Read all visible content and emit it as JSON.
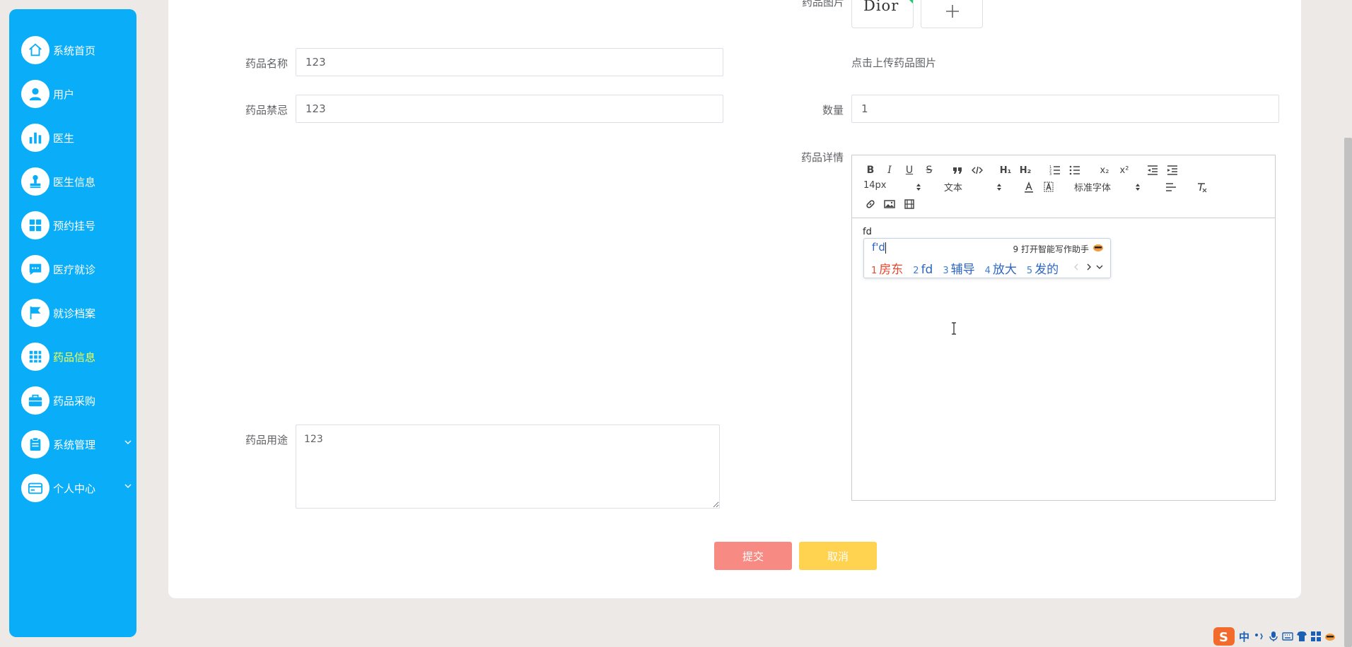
{
  "sidebar": {
    "items": [
      {
        "label": "系统首页",
        "icon": "home-icon"
      },
      {
        "label": "用户",
        "icon": "user-icon"
      },
      {
        "label": "医生",
        "icon": "bar-chart-icon"
      },
      {
        "label": "医生信息",
        "icon": "stamp-icon"
      },
      {
        "label": "预约挂号",
        "icon": "grid-icon"
      },
      {
        "label": "医疗就诊",
        "icon": "chat-icon"
      },
      {
        "label": "就诊档案",
        "icon": "flag-icon"
      },
      {
        "label": "药品信息",
        "icon": "apps-icon",
        "active": true
      },
      {
        "label": "药品采购",
        "icon": "briefcase-icon"
      },
      {
        "label": "系统管理",
        "icon": "clipboard-icon",
        "expandable": true
      },
      {
        "label": "个人中心",
        "icon": "card-icon",
        "expandable": true
      }
    ],
    "background": "#0aaef8",
    "active_color": "#f3ff4d"
  },
  "form": {
    "image_label": "药品图片",
    "image_thumb_text": "Dior",
    "upload_hint": "点击上传药品图片",
    "name_label": "药品名称",
    "name_value": "123",
    "taboo_label": "药品禁忌",
    "taboo_value": "123",
    "quantity_label": "数量",
    "quantity_value": "1",
    "detail_label": "药品详情",
    "usage_label": "药品用途",
    "usage_value": "123"
  },
  "editor": {
    "font_size": "14px",
    "header_select": "文本",
    "font_family": "标准字体",
    "content": "fd",
    "buttons": {
      "bold": "B",
      "italic": "I",
      "underline": "U",
      "strike": "S",
      "h1": "H₁",
      "h2": "H₂",
      "sub": "x₂",
      "sup": "x²"
    }
  },
  "ime": {
    "input": "f'd",
    "assistant": "9 打开智能写作助手",
    "candidates": [
      {
        "num": "1",
        "text": "房东"
      },
      {
        "num": "2",
        "text": "fd"
      },
      {
        "num": "3",
        "text": "辅导"
      },
      {
        "num": "4",
        "text": "放大"
      },
      {
        "num": "5",
        "text": "发的"
      }
    ]
  },
  "buttons": {
    "submit": "提交",
    "cancel": "取消"
  },
  "tray": {
    "lang": "中"
  }
}
